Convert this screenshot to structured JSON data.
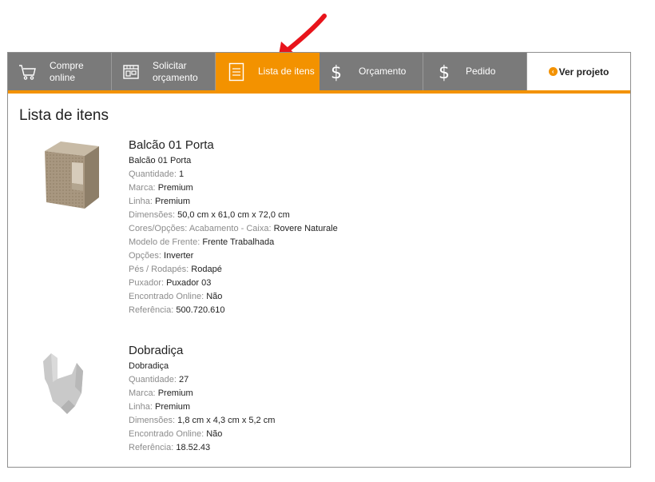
{
  "nav": {
    "tabs": [
      {
        "line1": "Compre",
        "line2": "online",
        "icon": "cart-icon"
      },
      {
        "line1": "Solicitar",
        "line2": "orçamento",
        "icon": "store-icon"
      },
      {
        "line1": "Lista de itens",
        "icon": "list-icon",
        "active": true
      },
      {
        "line1": "Orçamento",
        "icon": "dollar-icon"
      },
      {
        "line1": "Pedido",
        "icon": "dollar-icon"
      }
    ],
    "ver_projeto": "Ver projeto"
  },
  "page": {
    "title": "Lista de itens"
  },
  "items": [
    {
      "name": "Balcão 01 Porta",
      "subtitle": "Balcão 01 Porta",
      "fields": [
        {
          "k": "Quantidade:",
          "v": "1"
        },
        {
          "k": "Marca:",
          "v": "Premium"
        },
        {
          "k": "Linha:",
          "v": "Premium"
        },
        {
          "k": "Dimensões:",
          "v": "50,0 cm x 61,0 cm x 72,0 cm"
        },
        {
          "k": "Cores/Opções: Acabamento - Caixa:",
          "v": "Rovere Naturale"
        },
        {
          "k": "Modelo de Frente:",
          "v": "Frente Trabalhada"
        },
        {
          "k": "Opções:",
          "v": "Inverter"
        },
        {
          "k": "Pés / Rodapés:",
          "v": "Rodapé"
        },
        {
          "k": "Puxador:",
          "v": "Puxador 03"
        },
        {
          "k": "Encontrado Online:",
          "v": "Não"
        },
        {
          "k": "Referência:",
          "v": "500.720.610"
        }
      ]
    },
    {
      "name": "Dobradiça",
      "subtitle": "Dobradiça",
      "fields": [
        {
          "k": "Quantidade:",
          "v": "27"
        },
        {
          "k": "Marca:",
          "v": "Premium"
        },
        {
          "k": "Linha:",
          "v": "Premium"
        },
        {
          "k": "Dimensões:",
          "v": "1,8 cm x 4,3 cm x 5,2 cm"
        },
        {
          "k": "Encontrado Online:",
          "v": "Não"
        },
        {
          "k": "Referência:",
          "v": "18.52.43"
        }
      ]
    }
  ],
  "colors": {
    "accent": "#f39200",
    "tab_bg": "#7a7a7a",
    "label": "#8c8c8c",
    "arrow": "#e8141b"
  }
}
